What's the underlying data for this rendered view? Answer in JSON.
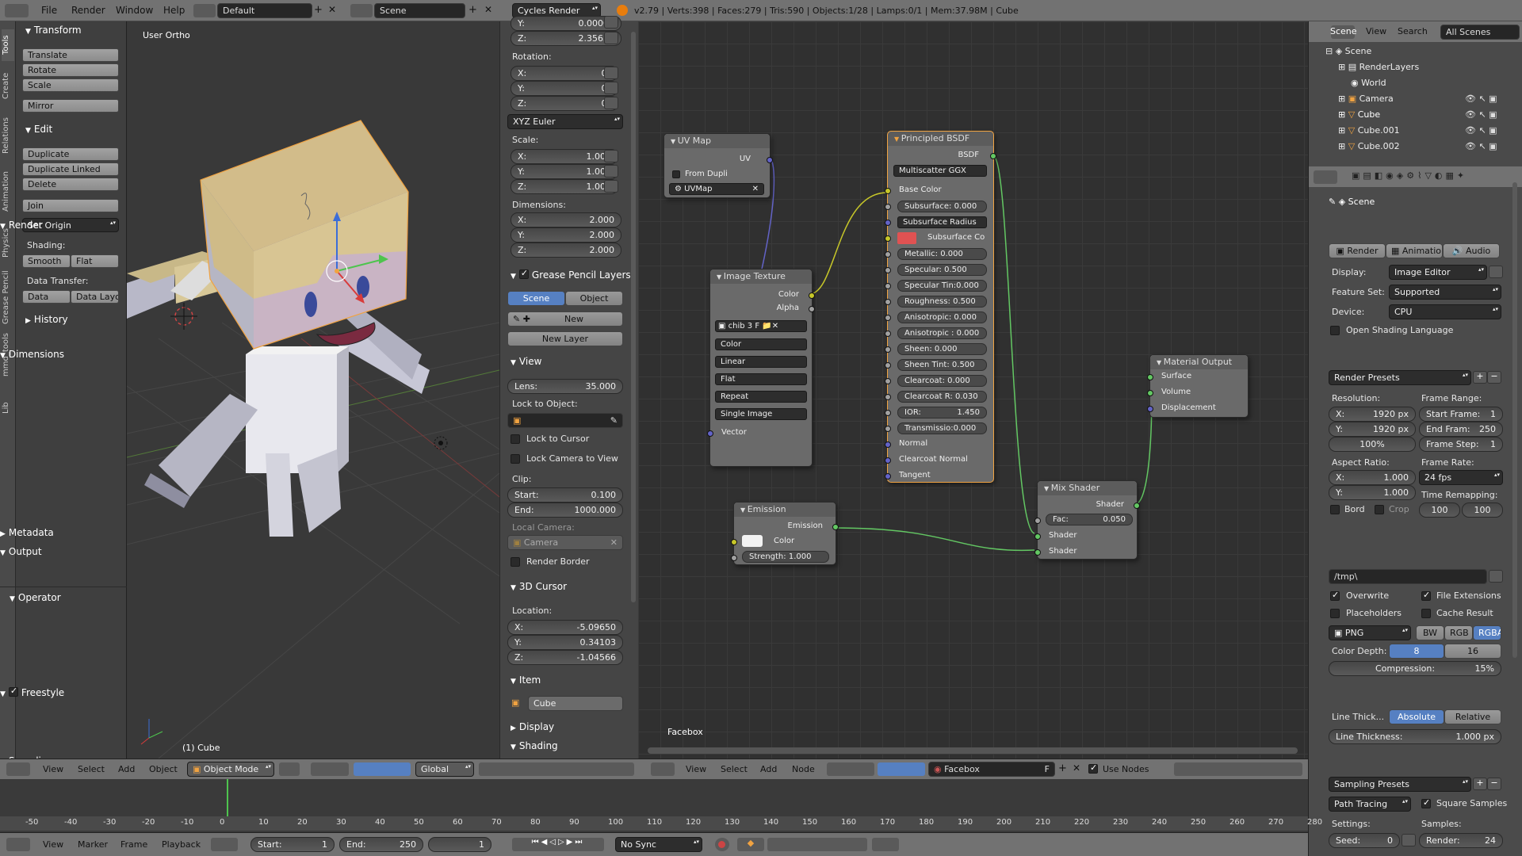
{
  "topbar": {
    "menus": [
      "File",
      "Render",
      "Window",
      "Help"
    ],
    "layout": "Default",
    "scene": "Scene",
    "engine": "Cycles Render",
    "stats": "v2.79 | Verts:398 | Faces:279 | Tris:590 | Objects:1/28 | Lamps:0/1 | Mem:37.98M | Cube"
  },
  "tabs": [
    "Tools",
    "Create",
    "Relations",
    "Animation",
    "Physics",
    "Grease Pencil",
    "mmd_tools",
    "Lib"
  ],
  "toolshelf": {
    "transform": "Transform",
    "translate": "Translate",
    "rotate": "Rotate",
    "scale": "Scale",
    "mirror": "Mirror",
    "edit": "Edit",
    "duplicate": "Duplicate",
    "duplicate_linked": "Duplicate Linked",
    "delete": "Delete",
    "join": "Join",
    "set_origin": "Set Origin",
    "shading": "Shading:",
    "smooth": "Smooth",
    "flat": "Flat",
    "data_transfer": "Data Transfer:",
    "data": "Data",
    "data_layo": "Data Layo",
    "history": "History",
    "operator": "Operator"
  },
  "viewport": {
    "label": "User Ortho",
    "object": "(1) Cube",
    "menus": [
      "View",
      "Select",
      "Add",
      "Object"
    ],
    "mode": "Object Mode",
    "orient": "Global"
  },
  "npanel": {
    "loc_y": "0.00000",
    "loc_z": "2.35659",
    "rotation": "Rotation:",
    "rot_x": "0°",
    "rot_y": "0°",
    "rot_z": "0°",
    "euler": "XYZ Euler",
    "scale": "Scale:",
    "sc_x": "1.000",
    "sc_y": "1.000",
    "sc_z": "1.000",
    "dimensions": "Dimensions:",
    "dim_x": "2.000",
    "dim_y": "2.000",
    "dim_z": "2.000",
    "gp_layers": "Grease Pencil Layers",
    "gp_scene": "Scene",
    "gp_object": "Object",
    "gp_new": "New",
    "new_layer": "New Layer",
    "view": "View",
    "lens": "35.000",
    "lens_lbl": "Lens:",
    "lock_obj": "Lock to Object:",
    "lock_cursor": "Lock to Cursor",
    "lock_cam": "Lock Camera to View",
    "clip": "Clip:",
    "clip_start": "0.100",
    "clip_end": "1000.000",
    "local_cam": "Local Camera:",
    "camera": "Camera",
    "render_border": "Render Border",
    "cursor3d": "3D Cursor",
    "location": "Location:",
    "cur_x": "-5.09650",
    "cur_y": "0.34103",
    "cur_z": "-1.04566",
    "item": "Item",
    "item_name": "Cube",
    "display": "Display",
    "shading": "Shading",
    "x": "X:",
    "y": "Y:",
    "z": "Z:",
    "start": "Start:",
    "end": "End:"
  },
  "nodes": {
    "uvmap": {
      "title": "UV Map",
      "uv": "UV",
      "from_dupli": "From Dupli",
      "map": "UVMap"
    },
    "imgtex": {
      "title": "Image Texture",
      "color": "Color",
      "alpha": "Alpha",
      "img": "chib",
      "users": "3",
      "fake": "F",
      "c1": "Color",
      "c2": "Linear",
      "c3": "Flat",
      "c4": "Repeat",
      "c5": "Single Image",
      "vector": "Vector"
    },
    "bsdf": {
      "title": "Principled BSDF",
      "bsdf": "BSDF",
      "dist": "Multiscatter GGX",
      "base": "Base Color",
      "ss": "Subsurface:",
      "ss_v": "0.000",
      "ssr": "Subsurface Radius",
      "ssc": "Subsurface Co",
      "met": "Metallic:",
      "met_v": "0.000",
      "spec": "Specular:",
      "spec_v": "0.500",
      "spt": "Specular Tin:",
      "spt_v": "0.000",
      "rough": "Roughness:",
      "rough_v": "0.500",
      "aniso": "Anisotropic:",
      "aniso_v": "0.000",
      "anr": "Anisotropic :",
      "anr_v": "0.000",
      "sheen": "Sheen:",
      "sheen_v": "0.000",
      "sht": "Sheen Tint:",
      "sht_v": "0.500",
      "cc": "Clearcoat:",
      "cc_v": "0.000",
      "ccr": "Clearcoat R:",
      "ccr_v": "0.030",
      "ior": "IOR:",
      "ior_v": "1.450",
      "trans": "Transmissio:",
      "trans_v": "0.000",
      "normal": "Normal",
      "ccn": "Clearcoat Normal",
      "tangent": "Tangent"
    },
    "emission": {
      "title": "Emission",
      "emission": "Emission",
      "color": "Color",
      "strength": "Strength:",
      "strength_v": "1.000"
    },
    "mix": {
      "title": "Mix Shader",
      "shader": "Shader",
      "fac": "Fac:",
      "fac_v": "0.050",
      "s1": "Shader",
      "s2": "Shader"
    },
    "output": {
      "title": "Material Output",
      "surface": "Surface",
      "volume": "Volume",
      "disp": "Displacement"
    },
    "material": "Facebox",
    "menus": [
      "View",
      "Select",
      "Add",
      "Node"
    ],
    "use_nodes": "Use Nodes",
    "fake": "F"
  },
  "outliner": {
    "menus": [
      "View",
      "Search"
    ],
    "filter": "All Scenes",
    "items": [
      "Scene",
      "RenderLayers",
      "World",
      "Camera",
      "Cube",
      "Cube.001",
      "Cube.002"
    ]
  },
  "props": {
    "scene": "Scene",
    "render": "Render",
    "b_render": "Render",
    "b_anim": "Animation",
    "b_audio": "Audio",
    "display_l": "Display:",
    "display": "Image Editor",
    "feature_l": "Feature Set:",
    "feature": "Supported",
    "device_l": "Device:",
    "device": "CPU",
    "osl": "Open Shading Language",
    "dimensions": "Dimensions",
    "presets": "Render Presets",
    "resolution": "Resolution:",
    "res_x": "1920 px",
    "res_y": "1920 px",
    "res_pct": "100%",
    "frame_range": "Frame Range:",
    "start_f": "Start Frame:",
    "start_f_v": "1",
    "end_f": "End Fram:",
    "end_f_v": "250",
    "step": "Frame Step:",
    "step_v": "1",
    "aspect": "Aspect Ratio:",
    "asp_x": "1.000",
    "asp_y": "1.000",
    "frame_rate": "Frame Rate:",
    "fps": "24 fps",
    "time_remap": "Time Remapping:",
    "bord": "Bord",
    "crop": "Crop",
    "remap_a": "100",
    "remap_b": "100",
    "metadata": "Metadata",
    "output": "Output",
    "path": "/tmp\\",
    "overwrite": "Overwrite",
    "file_ext": "File Extensions",
    "placeholders": "Placeholders",
    "cache": "Cache Result",
    "format": "PNG",
    "bw": "BW",
    "rgb": "RGB",
    "rgba": "RGBA",
    "depth_l": "Color Depth:",
    "d8": "8",
    "d16": "16",
    "compression": "Compression:",
    "comp_v": "15%",
    "freestyle": "Freestyle",
    "line_thick": "Line Thick...",
    "absolute": "Absolute",
    "relative": "Relative",
    "lt_l": "Line Thickness:",
    "lt_v": "1.000 px",
    "sampling": "Sampling",
    "samp_presets": "Sampling Presets",
    "path_tracing": "Path Tracing",
    "square": "Square Samples",
    "settings": "Settings:",
    "samples": "Samples:",
    "seed": "Seed:",
    "seed_v": "0",
    "render_s": "Render:",
    "render_s_v": "24",
    "x": "X:",
    "y": "Y:"
  },
  "timeline": {
    "ticks": [
      "-50",
      "-40",
      "-30",
      "-20",
      "-10",
      "0",
      "10",
      "20",
      "30",
      "40",
      "50",
      "60",
      "70",
      "80",
      "90",
      "100",
      "110",
      "120",
      "130",
      "140",
      "150",
      "160",
      "170",
      "180",
      "190",
      "200",
      "210",
      "220",
      "230",
      "240",
      "250",
      "260",
      "270",
      "280"
    ],
    "menus": [
      "View",
      "Marker",
      "Frame",
      "Playback"
    ],
    "start": "Start:",
    "start_v": "1",
    "end": "End:",
    "end_v": "250",
    "current": "1",
    "sync": "No Sync"
  },
  "colors": {
    "accent": "#5680c2",
    "selected": "#f1a341",
    "sock_yellow": "#c7c729",
    "sock_green": "#63c763",
    "sock_blue": "#6363c7",
    "subsurface_color": "#e05252"
  }
}
